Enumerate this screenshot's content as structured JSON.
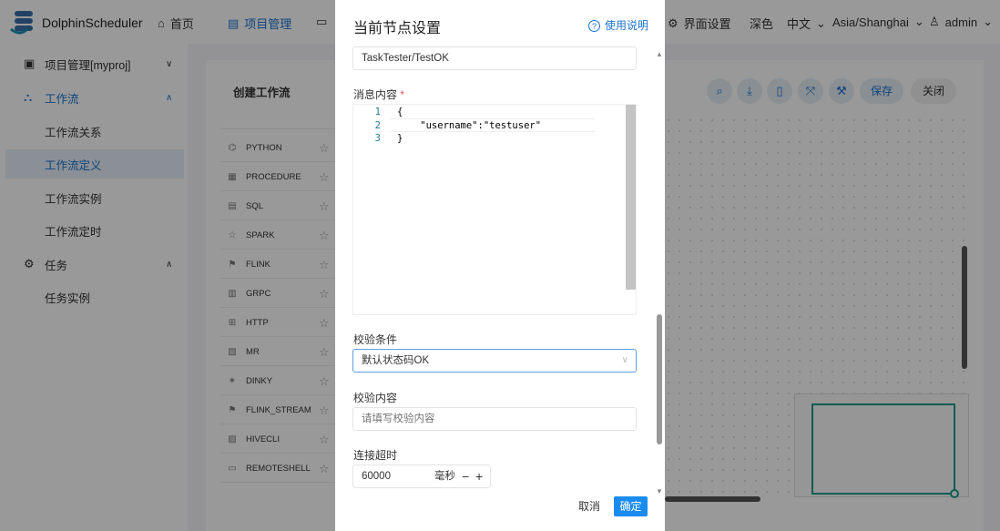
{
  "header": {
    "brand": "DolphinScheduler",
    "nav": [
      {
        "label": "首页"
      },
      {
        "label": "项目管理"
      }
    ],
    "ui_settings": "界面设置",
    "theme": "深色",
    "language": "中文",
    "timezone": "Asia/Shanghai",
    "user": "admin"
  },
  "sidebar": {
    "items": [
      {
        "label": "项目管理[myproj]"
      },
      {
        "label": "工作流"
      },
      {
        "label": "工作流关系"
      },
      {
        "label": "工作流定义"
      },
      {
        "label": "工作流实例"
      },
      {
        "label": "工作流定时"
      },
      {
        "label": "任务"
      },
      {
        "label": "任务实例"
      }
    ]
  },
  "workflow": {
    "title": "创建工作流",
    "toolbar": {
      "save": "保存",
      "close": "关闭"
    },
    "tasks": [
      "PYTHON",
      "PROCEDURE",
      "SQL",
      "SPARK",
      "FLINK",
      "GRPC",
      "HTTP",
      "MR",
      "DINKY",
      "FLINK_STREAM",
      "HIVECLI",
      "REMOTESHELL"
    ]
  },
  "modal": {
    "title": "当前节点设置",
    "help": "使用说明",
    "path_value": "TaskTester/TestOK",
    "message_label": "消息内容",
    "required_mark": "*",
    "code_lines": [
      {
        "n": "1",
        "t": "{"
      },
      {
        "n": "2",
        "t": "    \"username\":\"testuser\""
      },
      {
        "n": "3",
        "t": "}"
      }
    ],
    "check_condition_label": "校验条件",
    "check_condition_value": "默认状态码OK",
    "check_content_label": "校验内容",
    "check_content_placeholder": "请填写校验内容",
    "timeout_label": "连接超时",
    "timeout_value": "60000",
    "timeout_unit": "毫秒",
    "minus": "−",
    "plus": "+",
    "cancel": "取消",
    "confirm": "确定"
  },
  "colors": {
    "accent": "#1a73d0",
    "minimap": "#1a9a8a"
  }
}
